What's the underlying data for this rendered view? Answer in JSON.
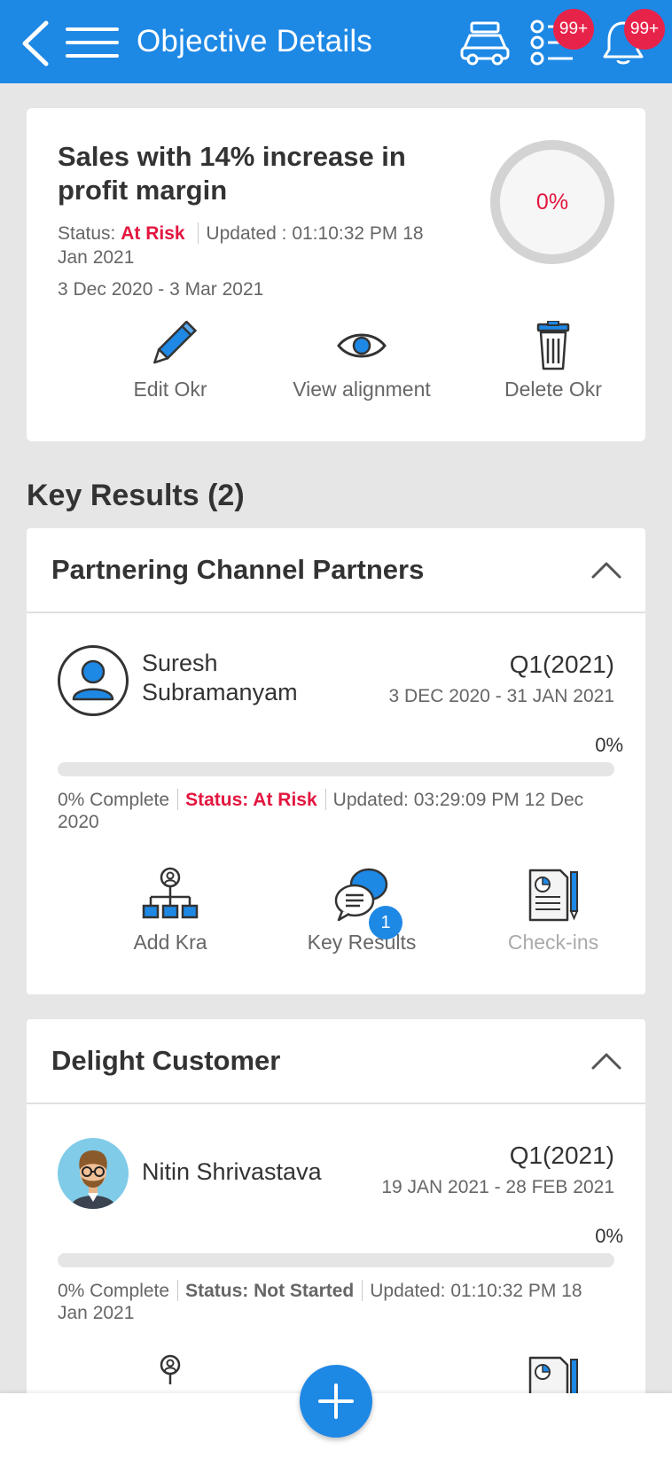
{
  "header": {
    "title": "Objective Details",
    "tasks_badge": "99+",
    "notifications_badge": "99+",
    "accent": "#1e88e5"
  },
  "objective": {
    "title": "Sales with 14% increase in profit margin",
    "status_label": "Status:",
    "status_value": "At Risk",
    "updated": "Updated : 01:10:32 PM 18 Jan 2021",
    "dates": "3 Dec 2020 - 3 Mar 2021",
    "progress": "0%",
    "actions": {
      "edit": "Edit Okr",
      "view": "View alignment",
      "delete": "Delete Okr"
    }
  },
  "key_results_title": "Key Results (2)",
  "key_results": [
    {
      "name": "Partnering Channel Partners",
      "owner": "Suresh Subramanyam",
      "quarter": "Q1(2021)",
      "range": "3 DEC 2020 - 31 JAN 2021",
      "percent": "0%",
      "complete": "0% Complete",
      "status": "Status: At Risk",
      "updated": "Updated: 03:29:09 PM 12 Dec 2020",
      "actions": {
        "add_kra": "Add Kra",
        "key_results": "Key Results",
        "key_results_count": "1",
        "checkins": "Check-ins"
      }
    },
    {
      "name": "Delight Customer",
      "owner": "Nitin Shrivastava",
      "quarter": "Q1(2021)",
      "range": "19 JAN 2021 - 28 FEB 2021",
      "percent": "0%",
      "complete": "0% Complete",
      "status": "Status: Not Started",
      "updated": "Updated: 01:10:32 PM 18 Jan 2021"
    }
  ],
  "colors": {
    "risk": "#e3163f",
    "badge": "#e8234a",
    "icon_blue": "#1e88e5"
  }
}
